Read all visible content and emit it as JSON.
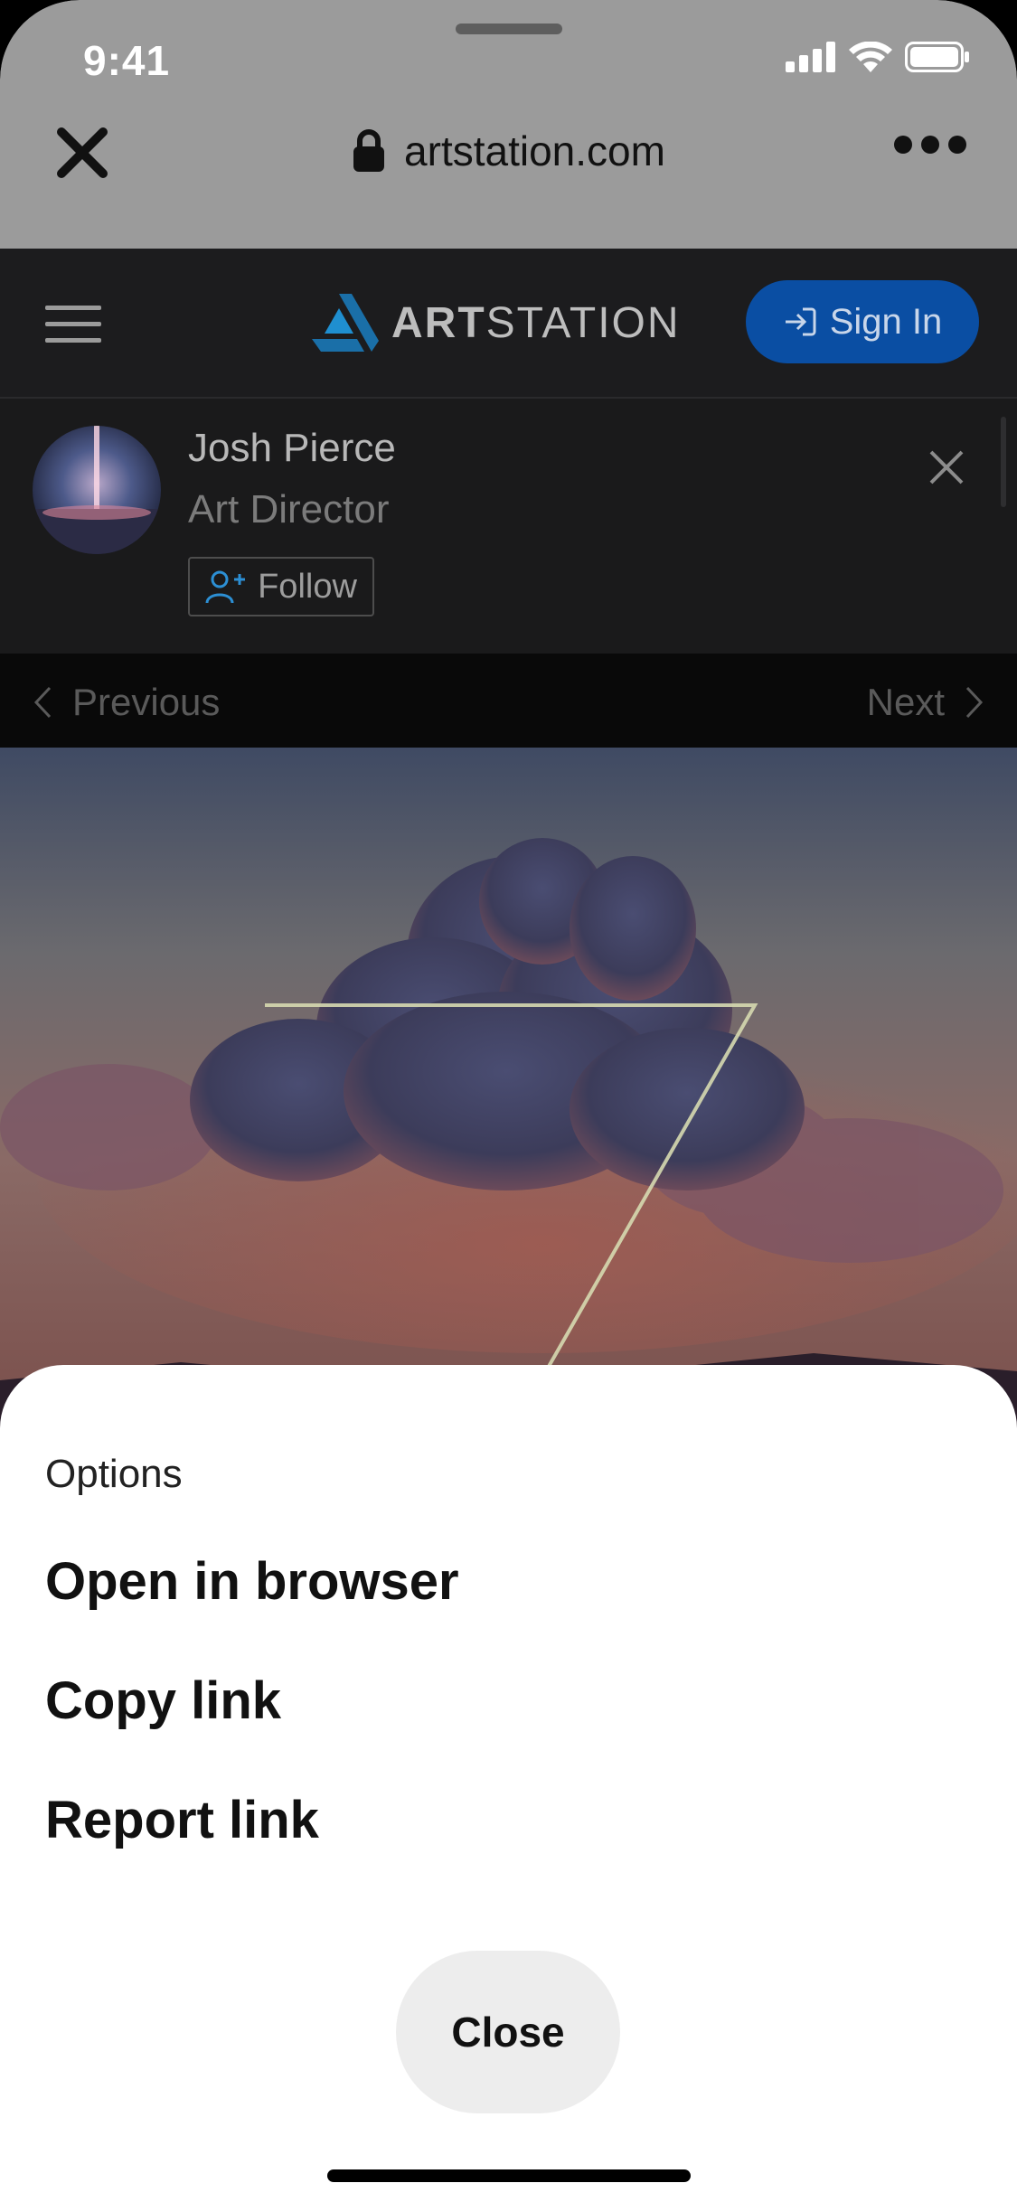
{
  "status_bar": {
    "time": "9:41"
  },
  "browser": {
    "url": "artstation.com"
  },
  "artstation": {
    "brand_bold": "ART",
    "brand_light": "STATION",
    "sign_in_label": "Sign In"
  },
  "profile": {
    "name": "Josh Pierce",
    "role": "Art Director",
    "follow_label": "Follow"
  },
  "pager": {
    "previous_label": "Previous",
    "next_label": "Next"
  },
  "sheet": {
    "title": "Options",
    "options": [
      "Open in browser",
      "Copy link",
      "Report link"
    ],
    "close_label": "Close"
  },
  "colors": {
    "accent": "#0a4ea3",
    "sheet_bg": "#ffffff",
    "chrome_bg": "#9b9b9b"
  }
}
